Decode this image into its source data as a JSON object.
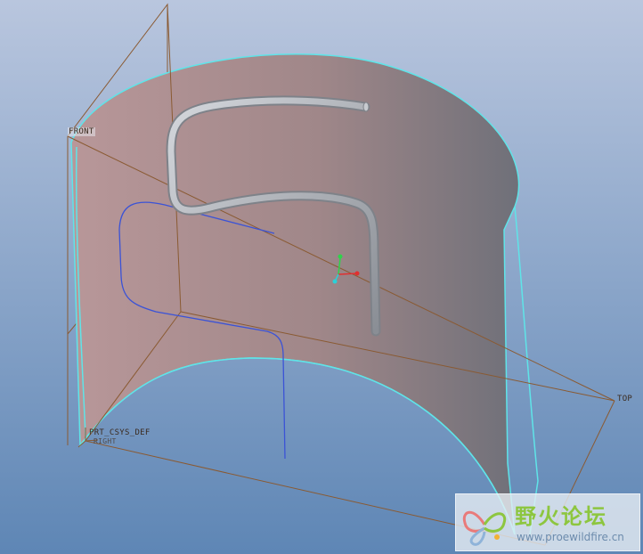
{
  "viewport": {
    "background_top": "#b9c6de",
    "background_bottom": "#5e86b5"
  },
  "datums": {
    "front_label": "FRONT",
    "top_label": "TOP",
    "csys_label": "PRT_CSYS_DEF",
    "csys_sublabel": "RIGHT"
  },
  "colors": {
    "surface_left": "#b89799",
    "surface_right": "#6f7079",
    "surface_edge": "#5fe4e8",
    "datum_plane": "#8a5a32",
    "sketch_curve": "#3b53d6",
    "pipe": "#a9adb3"
  },
  "triad": {
    "x_color": "#e03030",
    "y_color": "#2fd34a",
    "z_color": "#2bd0d8"
  },
  "watermark": {
    "title": "野火论坛",
    "url": "www.proewildfire.cn",
    "logo_icon": "butterfly-icon"
  }
}
